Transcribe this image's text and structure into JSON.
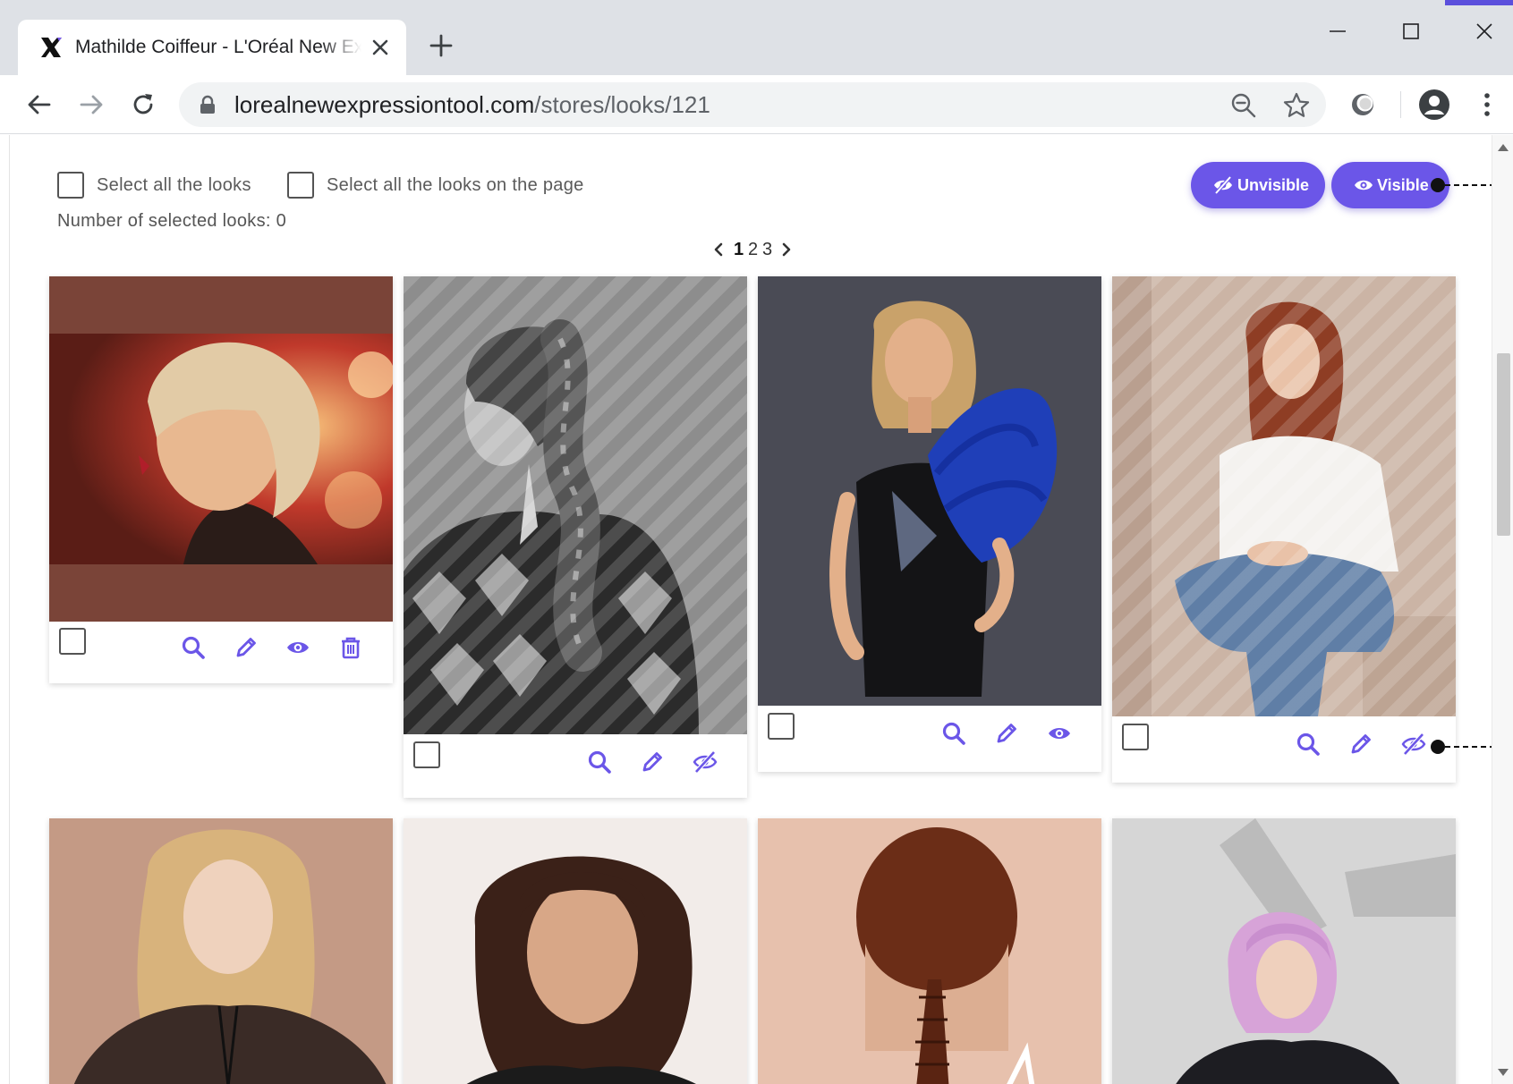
{
  "browser": {
    "tab_title": "Mathilde Coiffeur - L'Oréal New Expression Tool",
    "url_host": "lorealnewexpressiontool.com",
    "url_path": "/stores/looks/121",
    "accent_color": "#5b4fdc"
  },
  "selection": {
    "select_all_label": "Select all the looks",
    "select_page_label": "Select all the looks on the page",
    "count_label": "Number of selected looks:",
    "count_value": "0"
  },
  "actions": {
    "unvisible_label": "Unvisible",
    "visible_label": "Visible",
    "button_color": "#6b56e8"
  },
  "pagination": {
    "pages": [
      "1",
      "2",
      "3"
    ],
    "current": "1"
  },
  "looks": [
    {
      "status": "visible",
      "actions": [
        "search-icon",
        "edit-pencil-icon",
        "eye-icon",
        "trash-icon"
      ],
      "colors": [
        "#7a4438",
        "#e8b890"
      ]
    },
    {
      "status": "hidden",
      "actions": [
        "search-icon",
        "edit-pencil-icon",
        "eye-slash-icon"
      ],
      "colors": [
        "#8a8a8a",
        "#2b2b2b"
      ]
    },
    {
      "status": "visible",
      "actions": [
        "search-icon",
        "edit-pencil-icon",
        "eye-icon"
      ],
      "colors": [
        "#4a4b55",
        "#1f3fb8"
      ]
    },
    {
      "status": "hidden",
      "actions": [
        "search-icon",
        "edit-pencil-icon",
        "eye-slash-icon"
      ],
      "colors": [
        "#c9b3a5",
        "#5f7ea6"
      ]
    },
    {
      "status": "unknown",
      "actions": [],
      "colors": [
        "#c49a85",
        "#3a2b26"
      ]
    },
    {
      "status": "unknown",
      "actions": [],
      "colors": [
        "#f2ece9",
        "#3b2118"
      ]
    },
    {
      "status": "unknown",
      "actions": [],
      "colors": [
        "#e7c1ad",
        "#6b2d17"
      ]
    },
    {
      "status": "unknown",
      "actions": [],
      "colors": [
        "#cfcfcf",
        "#d7a3d8"
      ]
    }
  ]
}
